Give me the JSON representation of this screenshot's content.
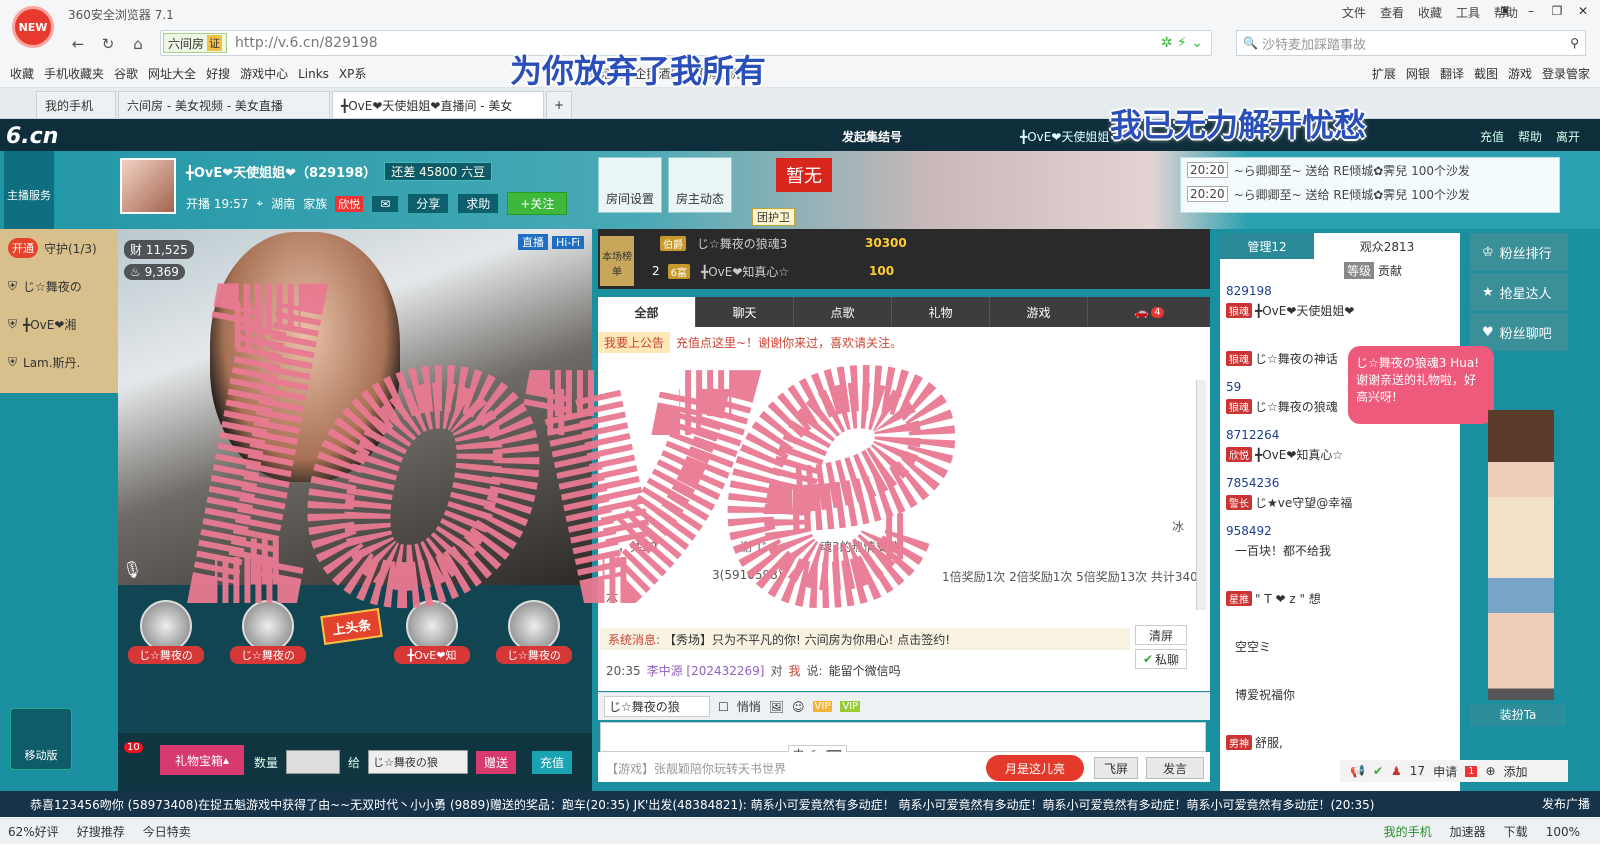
{
  "browser": {
    "logo": "NEW",
    "title": "360安全浏览器 7.1",
    "menu": [
      "文件",
      "查看",
      "收藏",
      "工具",
      "帮助"
    ],
    "url_tag": "六间房",
    "url_cert": "证",
    "url": "http://v.6.cn/829198",
    "search_placeholder": "沙特麦加踩踏事故",
    "bookmarks": [
      "收藏",
      "手机收藏夹",
      "谷歌",
      "网址大全",
      "好搜",
      "游戏中心",
      "Links",
      "XP系",
      "优惠活动",
      "企鹅酒店",
      "【携程机"
    ],
    "tools": [
      "扩展",
      "网银",
      "翻译",
      "截图",
      "游戏",
      "登录管家"
    ],
    "tabs": [
      {
        "label": "我的手机"
      },
      {
        "label": "六间房 - 美女视频 - 美女直播"
      },
      {
        "label": "╋OvE❤天使姐姐❤直播间 - 美女"
      }
    ],
    "status": {
      "rating": "62%好评",
      "recommend": "好搜推荐",
      "sale": "今日特卖",
      "phone": "我的手机",
      "speed": "加速器",
      "download": "下载",
      "zoom": "100%"
    }
  },
  "site": {
    "logo": "6.cn",
    "hdr_event": "发起集结号",
    "hdr_user": "╋OvE❤天使姐姐",
    "hdr_links": [
      "充值",
      "帮助",
      "离开"
    ],
    "kefu": "主播服务",
    "host": {
      "name": "╋OvE❤天使姐姐❤（829198）",
      "level_need": "还差 45800 六豆",
      "time": "开播 19:57",
      "location": "湖南",
      "family_label": "家族",
      "family": "欣悦",
      "share": "分享",
      "ask": "求助",
      "follow": "+关注"
    },
    "room_buttons": [
      "房间设置",
      "房主动态"
    ],
    "zanwu": "暂无",
    "tuanhu": "团护卫",
    "gift_notices": [
      {
        "time": "20:20",
        "text": "~ら卿卿至~ 送给 RE倾城✿霁兒 100个沙发"
      },
      {
        "time": "20:20",
        "text": "~ら卿卿至~ 送给 RE倾城✿霁兒 100个沙发"
      }
    ],
    "guard": {
      "open": "开通",
      "title": "守护(1/3)",
      "members": [
        "じ☆舞夜の",
        "╋OvE❤湘",
        "Lam.斯丹."
      ]
    },
    "video": {
      "wealth": "11,525",
      "fans": "9,369",
      "tags": [
        "直播",
        "Hi-Fi"
      ]
    },
    "fans_row": [
      "じ☆舞夜の",
      "じ☆舞夜の",
      "╋OvE❤知",
      "じ☆舞夜の"
    ],
    "toutiao": "上头条",
    "giftbar": {
      "count_badge": "10",
      "giftbox": "礼物宝箱",
      "qty_label": "数量",
      "give_label": "给",
      "target": "じ☆舞夜の狼",
      "give": "赠送",
      "recharge": "充值"
    },
    "mobile": "移动版",
    "rank": {
      "label": "本场榜单",
      "rows": [
        {
          "pos": "",
          "badge": "伯爵",
          "name": "じ☆舞夜の狼魂3",
          "score": "30300"
        },
        {
          "pos": "2",
          "badge": "6富",
          "name": "╋OvE❤知真心☆",
          "score": "100"
        }
      ]
    },
    "chat": {
      "tabs": [
        "全部",
        "聊天",
        "点歌",
        "礼物",
        "游戏"
      ],
      "car_count": "4",
      "announce_tag": "我要上公告",
      "announce": "充值点这里~！谢谢你来过，喜欢请关注。",
      "lines": [
        "，共30",
        "谢 じ☆",
        "魂3的热情支持!",
        "3(5910598)",
        "1倍奖励1次 2倍奖励1次 5倍奖励13次 共计340",
        "六",
        "冰"
      ],
      "sys_label": "系统消息:",
      "sys": "【秀场】只为不平凡的你! 六间房为你用心! 点击签约!",
      "msg_time": "20:35",
      "msg_user": "李中源 [202432269]",
      "msg_to": "对",
      "msg_me": "我",
      "msg_say": "说:",
      "msg_text": "能留个微信吗",
      "clear": "清屏",
      "private": "私聊",
      "target": "じ☆舞夜の狼",
      "quiet": "悄悄",
      "vip": "VIP",
      "vip2": "VIP",
      "ime": "中",
      "game_msg": "【游戏】张靓颖陪你玩转天书世界",
      "month": "月是这儿亮",
      "fly": "飞屏",
      "send": "发言"
    },
    "users": {
      "tabs": [
        "管理12",
        "观众2813"
      ],
      "sub_tabs": [
        "等级",
        "贡献"
      ],
      "list": [
        {
          "id": "829198",
          "badge": "狼魂",
          "name": "╋OvE❤天使姐姐❤"
        },
        {
          "id": "",
          "badge": "狼魂",
          "name": "じ☆舞夜の神话"
        },
        {
          "id": "59",
          "badge": "狼魂",
          "name": "じ☆舞夜の狼魂"
        },
        {
          "id": "8712264",
          "badge": "欣悦",
          "name": "╋OvE❤知真心☆"
        },
        {
          "id": "7854236",
          "badge": "警长",
          "name": "じ★ve守望@幸福"
        },
        {
          "id": "958492",
          "badge": "",
          "name": "一百块！都不给我"
        },
        {
          "id": "",
          "badge": "星推",
          "name": "\" T ❤ z \" 想"
        },
        {
          "id": "",
          "badge": "",
          "name": "空空ミ"
        },
        {
          "id": "",
          "badge": "",
          "name": "博爱祝福你"
        },
        {
          "id": "",
          "badge": "男神",
          "name": "舒服,"
        }
      ]
    },
    "side": [
      "粉丝排行",
      "抢星达人",
      "粉丝聊吧"
    ],
    "bubble": "じ☆舞夜の狼魂3 Hua! 谢谢亲送的礼物啦，好高兴呀!",
    "zhuangban": "装扮Ta",
    "rbottom": {
      "count": "17",
      "apply": "申请",
      "add": "添加",
      "badge": "1"
    },
    "broadcast": "恭喜123456吻你 (58973408)在捉五魁游戏中获得了由~~无双时代丶小小勇 (9889)赠送的奖品：跑车(20:35)    JK'出发(48384821): 萌系小可爱竟然有多动症！ 萌系小可爱竟然有多动症！萌系小可爱竟然有多动症！萌系小可爱竟然有多动症！(20:35)",
    "fabu": "发布广播"
  },
  "overlays": {
    "lyric1": "为你放弃了我所有",
    "lyric2": "我已无力解开忧愁",
    "gift_letters": "love"
  }
}
